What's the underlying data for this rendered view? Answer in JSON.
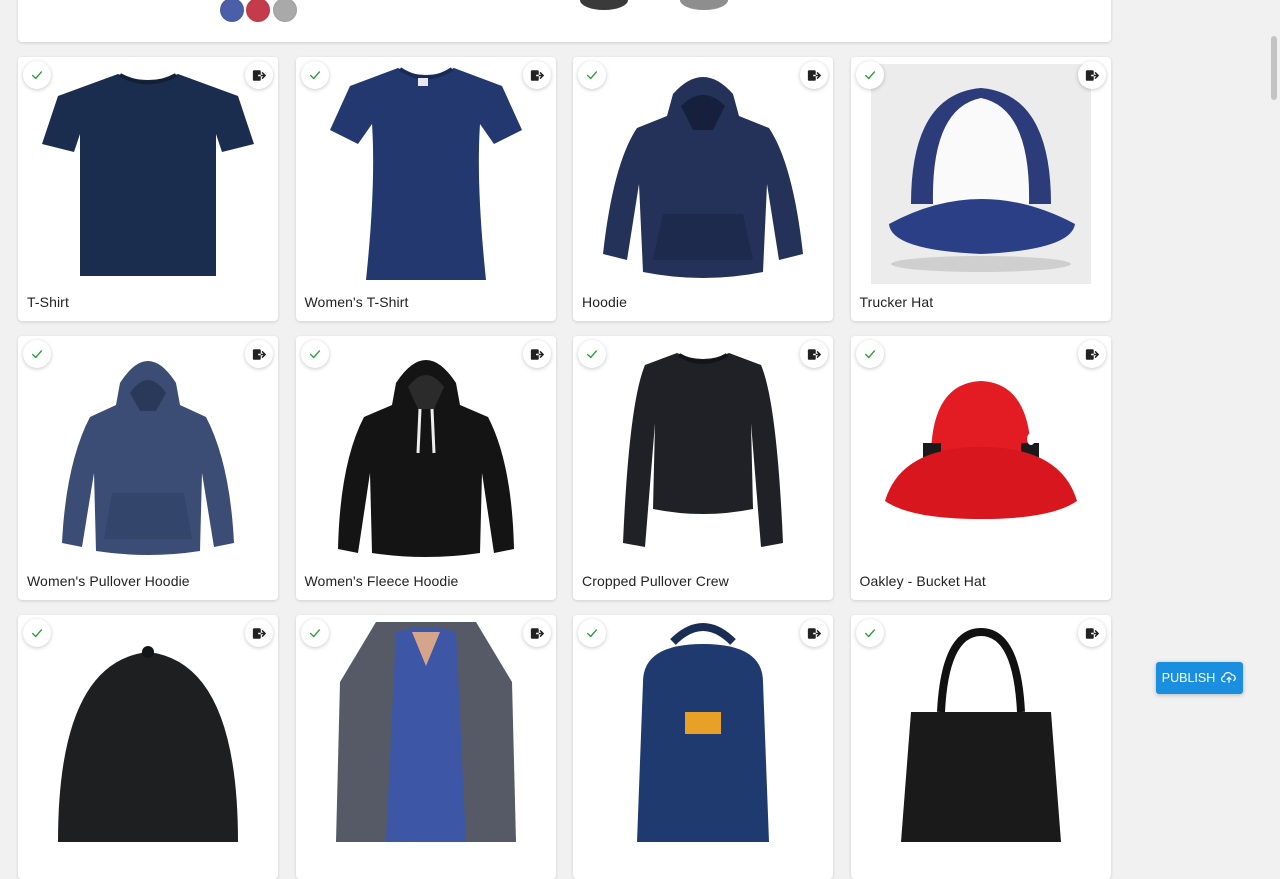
{
  "colors": {
    "accent": "#1a8fe0",
    "check": "#2e9d3d",
    "swatches": [
      "#4a5fa8",
      "#c43c4c",
      "#a9a9a9"
    ]
  },
  "publish": {
    "label": "PUBLISH",
    "icon": "cloud-upload-icon"
  },
  "products": [
    {
      "name": "T-Shirt",
      "selected": true,
      "image": "navy-tshirt"
    },
    {
      "name": "Women's T-Shirt",
      "selected": true,
      "image": "navy-womens-tshirt"
    },
    {
      "name": "Hoodie",
      "selected": true,
      "image": "navy-hoodie"
    },
    {
      "name": "Trucker Hat",
      "selected": true,
      "image": "navy-white-trucker-hat"
    },
    {
      "name": "Women's Pullover Hoodie",
      "selected": true,
      "image": "heather-navy-pullover-hoodie"
    },
    {
      "name": "Women's Fleece Hoodie",
      "selected": true,
      "image": "black-fleece-hoodie"
    },
    {
      "name": "Cropped Pullover Crew",
      "selected": true,
      "image": "black-cropped-crew"
    },
    {
      "name": "Oakley - Bucket Hat",
      "selected": true,
      "image": "red-bucket-hat"
    },
    {
      "name": "",
      "selected": true,
      "image": "black-beanie"
    },
    {
      "name": "",
      "selected": true,
      "image": "raglan-hoodie-model"
    },
    {
      "name": "",
      "selected": true,
      "image": "navy-carhartt-backpack"
    },
    {
      "name": "",
      "selected": true,
      "image": "black-tote-bag"
    }
  ]
}
